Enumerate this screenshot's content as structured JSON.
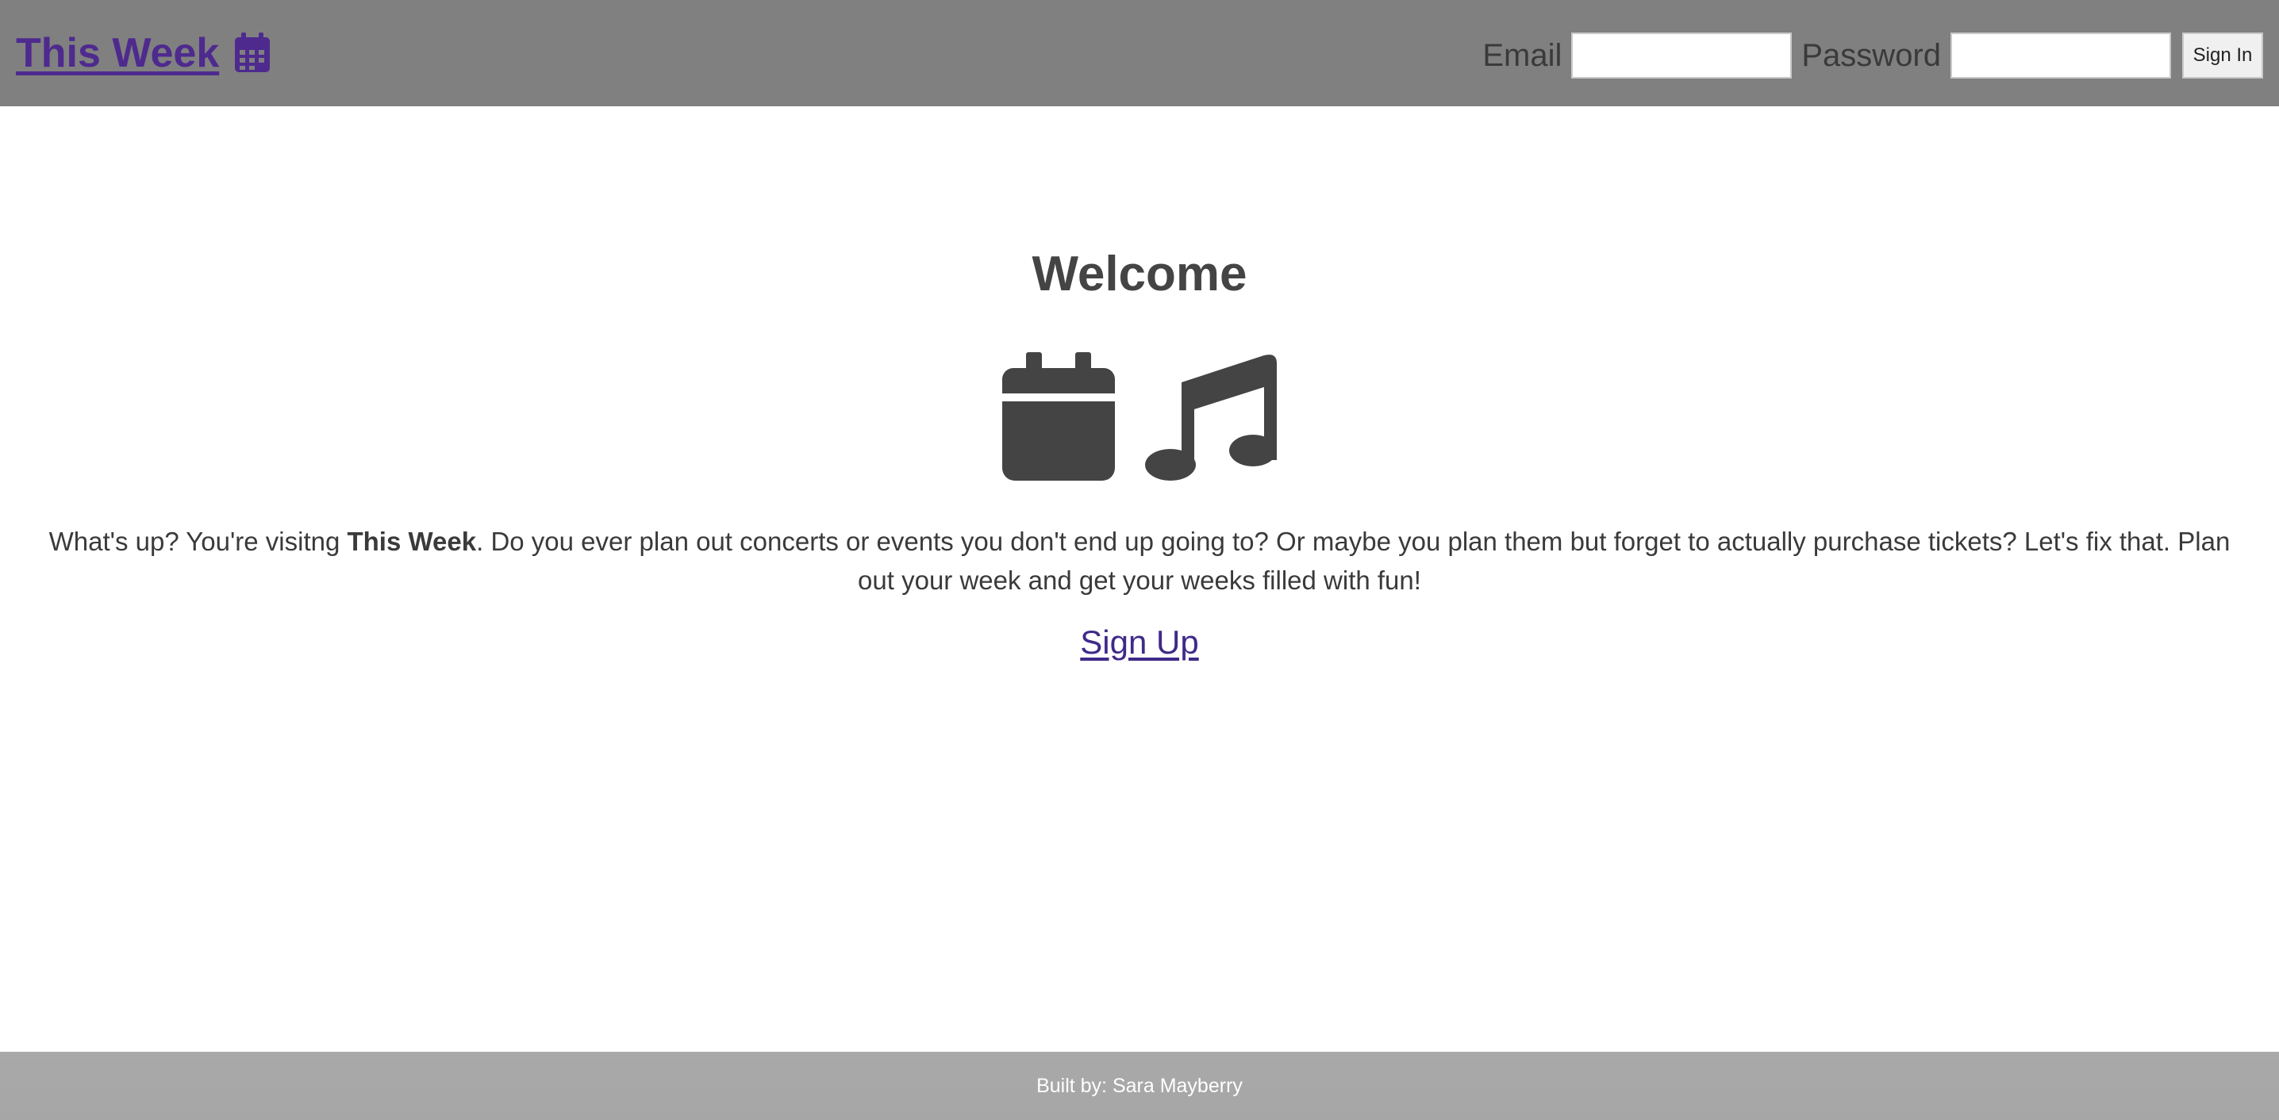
{
  "header": {
    "brand": "This Week",
    "brand_icon": "calendar-icon",
    "email_label": "Email",
    "email_value": "",
    "password_label": "Password",
    "password_value": "",
    "signin_label": "Sign In"
  },
  "main": {
    "title": "Welcome",
    "hero_icons": [
      "calendar-icon",
      "music-note-icon"
    ],
    "intro_before": "What's up? You're visitng ",
    "intro_bold": "This Week",
    "intro_after": ". Do you ever plan out concerts or events you don't end up going to? Or maybe you plan them but forget to actually purchase tickets? Let's fix that. Plan out your week and get your weeks filled with fun!",
    "signup_label": "Sign Up"
  },
  "footer": {
    "credit": "Built by: Sara Mayberry"
  },
  "colors": {
    "header_bg": "#808080",
    "brand": "#4e2a8e",
    "link": "#3f2a88",
    "text": "#444444",
    "footer_bg": "#a9a9a9"
  }
}
